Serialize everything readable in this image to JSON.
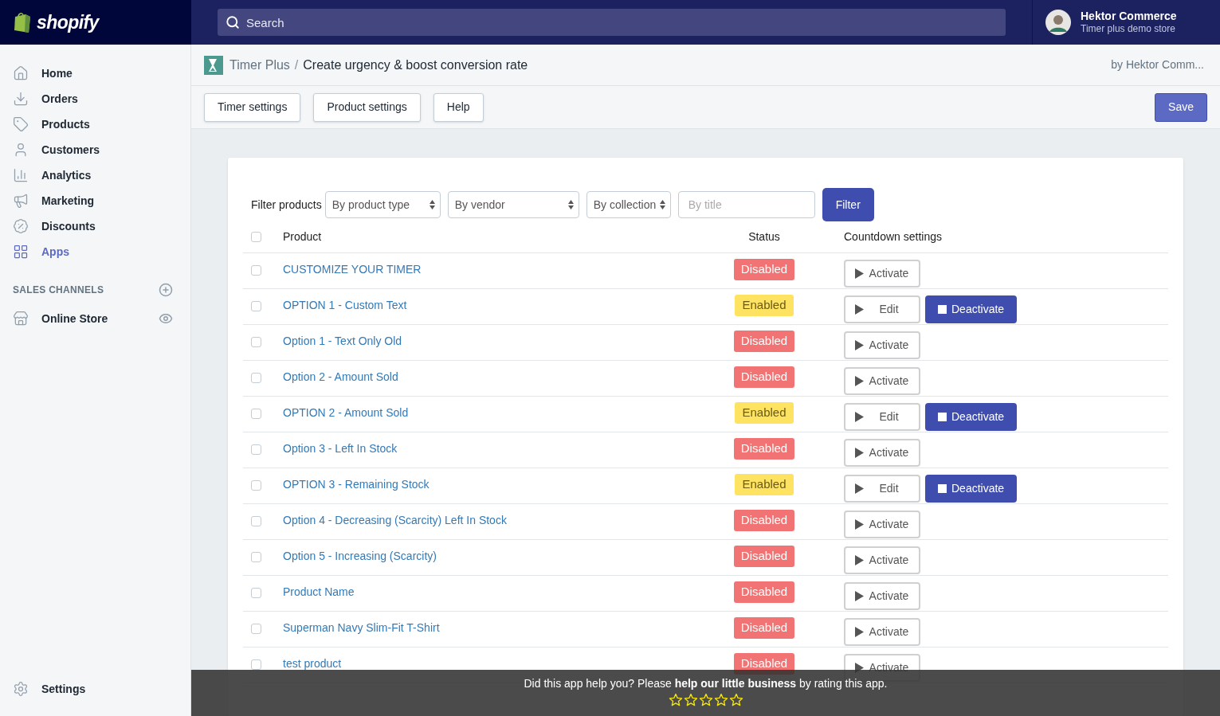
{
  "brand": "shopify",
  "search": {
    "placeholder": "Search"
  },
  "account": {
    "name": "Hektor Commerce",
    "store": "Timer plus demo store"
  },
  "sidebar": {
    "items": [
      {
        "label": "Home",
        "selected": false
      },
      {
        "label": "Orders",
        "selected": false
      },
      {
        "label": "Products",
        "selected": false
      },
      {
        "label": "Customers",
        "selected": false
      },
      {
        "label": "Analytics",
        "selected": false
      },
      {
        "label": "Marketing",
        "selected": false
      },
      {
        "label": "Discounts",
        "selected": false
      },
      {
        "label": "Apps",
        "selected": true
      }
    ],
    "section_title": "SALES CHANNELS",
    "channels": [
      {
        "label": "Online Store",
        "selected": false
      }
    ],
    "settings": "Settings"
  },
  "breadcrumb": {
    "app": "Timer Plus",
    "separator": "/",
    "page": "Create urgency & boost conversion rate",
    "author": "by Hektor Comm..."
  },
  "toolbar": {
    "buttons": [
      "Timer settings",
      "Product settings",
      "Help"
    ],
    "save": "Save"
  },
  "filter": {
    "label": "Filter products",
    "selects": [
      "By product type",
      "By vendor",
      "By collection"
    ],
    "title_placeholder": "By title",
    "button": "Filter"
  },
  "table": {
    "columns": [
      "Product",
      "Status",
      "Countdown settings"
    ],
    "all_checked": false,
    "rows": [
      {
        "product": "CUSTOMIZE YOUR TIMER",
        "checked": false,
        "status": "Disabled",
        "enabled": false,
        "actions": [
          {
            "label": "Activate",
            "kind": "play"
          }
        ]
      },
      {
        "product": "OPTION 1 - Custom Text",
        "checked": false,
        "status": "Enabled",
        "enabled": true,
        "actions": [
          {
            "label": "Edit",
            "kind": "play"
          },
          {
            "label": "Deactivate",
            "kind": "stop"
          }
        ]
      },
      {
        "product": "Option 1 - Text Only Old",
        "checked": false,
        "status": "Disabled",
        "enabled": false,
        "actions": [
          {
            "label": "Activate",
            "kind": "play"
          }
        ]
      },
      {
        "product": "Option 2 - Amount Sold",
        "checked": false,
        "status": "Disabled",
        "enabled": false,
        "actions": [
          {
            "label": "Activate",
            "kind": "play"
          }
        ]
      },
      {
        "product": "OPTION 2 - Amount Sold",
        "checked": false,
        "status": "Enabled",
        "enabled": true,
        "actions": [
          {
            "label": "Edit",
            "kind": "play"
          },
          {
            "label": "Deactivate",
            "kind": "stop"
          }
        ]
      },
      {
        "product": "Option 3 - Left In Stock",
        "checked": false,
        "status": "Disabled",
        "enabled": false,
        "actions": [
          {
            "label": "Activate",
            "kind": "play"
          }
        ]
      },
      {
        "product": "OPTION 3 - Remaining Stock",
        "checked": false,
        "status": "Enabled",
        "enabled": true,
        "actions": [
          {
            "label": "Edit",
            "kind": "play"
          },
          {
            "label": "Deactivate",
            "kind": "stop"
          }
        ]
      },
      {
        "product": "Option 4 - Decreasing (Scarcity) Left In Stock",
        "checked": false,
        "status": "Disabled",
        "enabled": false,
        "actions": [
          {
            "label": "Activate",
            "kind": "play"
          }
        ]
      },
      {
        "product": "Option 5 - Increasing (Scarcity)",
        "checked": false,
        "status": "Disabled",
        "enabled": false,
        "actions": [
          {
            "label": "Activate",
            "kind": "play"
          }
        ]
      },
      {
        "product": "Product Name",
        "checked": false,
        "status": "Disabled",
        "enabled": false,
        "actions": [
          {
            "label": "Activate",
            "kind": "play"
          }
        ]
      },
      {
        "product": "Superman Navy Slim-Fit T-Shirt",
        "checked": false,
        "status": "Disabled",
        "enabled": false,
        "actions": [
          {
            "label": "Activate",
            "kind": "play"
          }
        ]
      },
      {
        "product": "test product",
        "checked": false,
        "status": "Disabled",
        "enabled": false,
        "actions": [
          {
            "label": "Activate",
            "kind": "play"
          }
        ]
      }
    ]
  },
  "rating_bar": {
    "text": "Did this app help you? Please **help our little business** by rating this app.",
    "stars": 0
  }
}
